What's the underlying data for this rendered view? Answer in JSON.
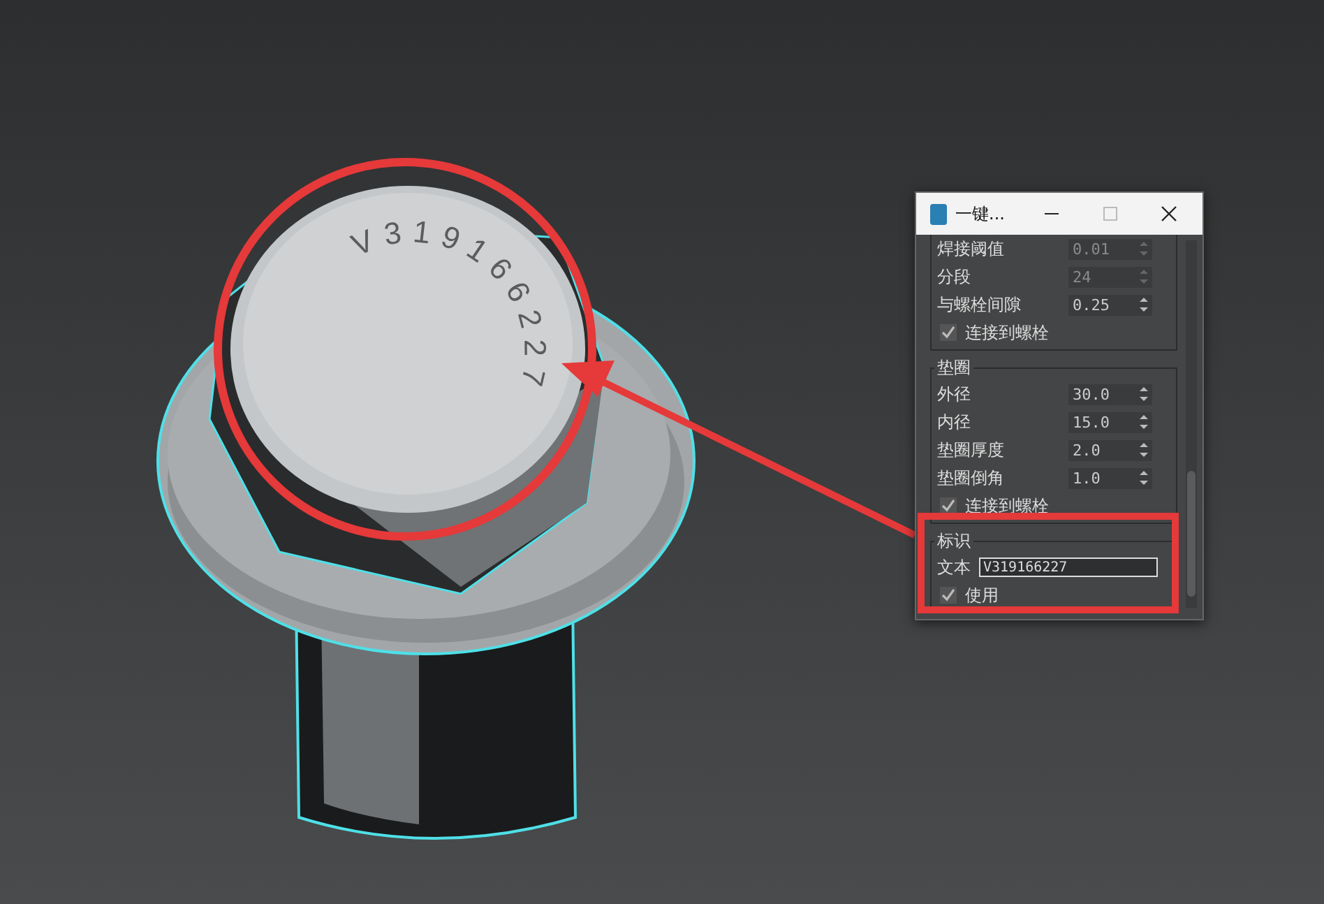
{
  "viewport": {
    "engraving": "V319166227"
  },
  "window": {
    "title": "一键..."
  },
  "groups": [
    {
      "rows": [
        {
          "kind": "spinner",
          "label": "焊接阈值",
          "value": "0.01",
          "disabled": true
        },
        {
          "kind": "spinner",
          "label": "分段",
          "value": "24",
          "disabled": true
        },
        {
          "kind": "spinner",
          "label": "与螺栓间隙",
          "value": "0.25",
          "disabled": false
        },
        {
          "kind": "checkbox",
          "label": "连接到螺栓",
          "checked": true
        }
      ]
    },
    {
      "title": "垫圈",
      "rows": [
        {
          "kind": "spinner",
          "label": "外径",
          "value": "30.0",
          "disabled": false
        },
        {
          "kind": "spinner",
          "label": "内径",
          "value": "15.0",
          "disabled": false
        },
        {
          "kind": "spinner",
          "label": "垫圈厚度",
          "value": "2.0",
          "disabled": false
        },
        {
          "kind": "spinner",
          "label": "垫圈倒角",
          "value": "1.0",
          "disabled": false
        },
        {
          "kind": "checkbox",
          "label": "连接到螺栓",
          "checked": true
        }
      ]
    },
    {
      "title": "标识",
      "rows": [
        {
          "kind": "text",
          "label": "文本",
          "value": "V319166227"
        },
        {
          "kind": "checkbox",
          "label": "使用",
          "checked": true
        }
      ]
    }
  ]
}
